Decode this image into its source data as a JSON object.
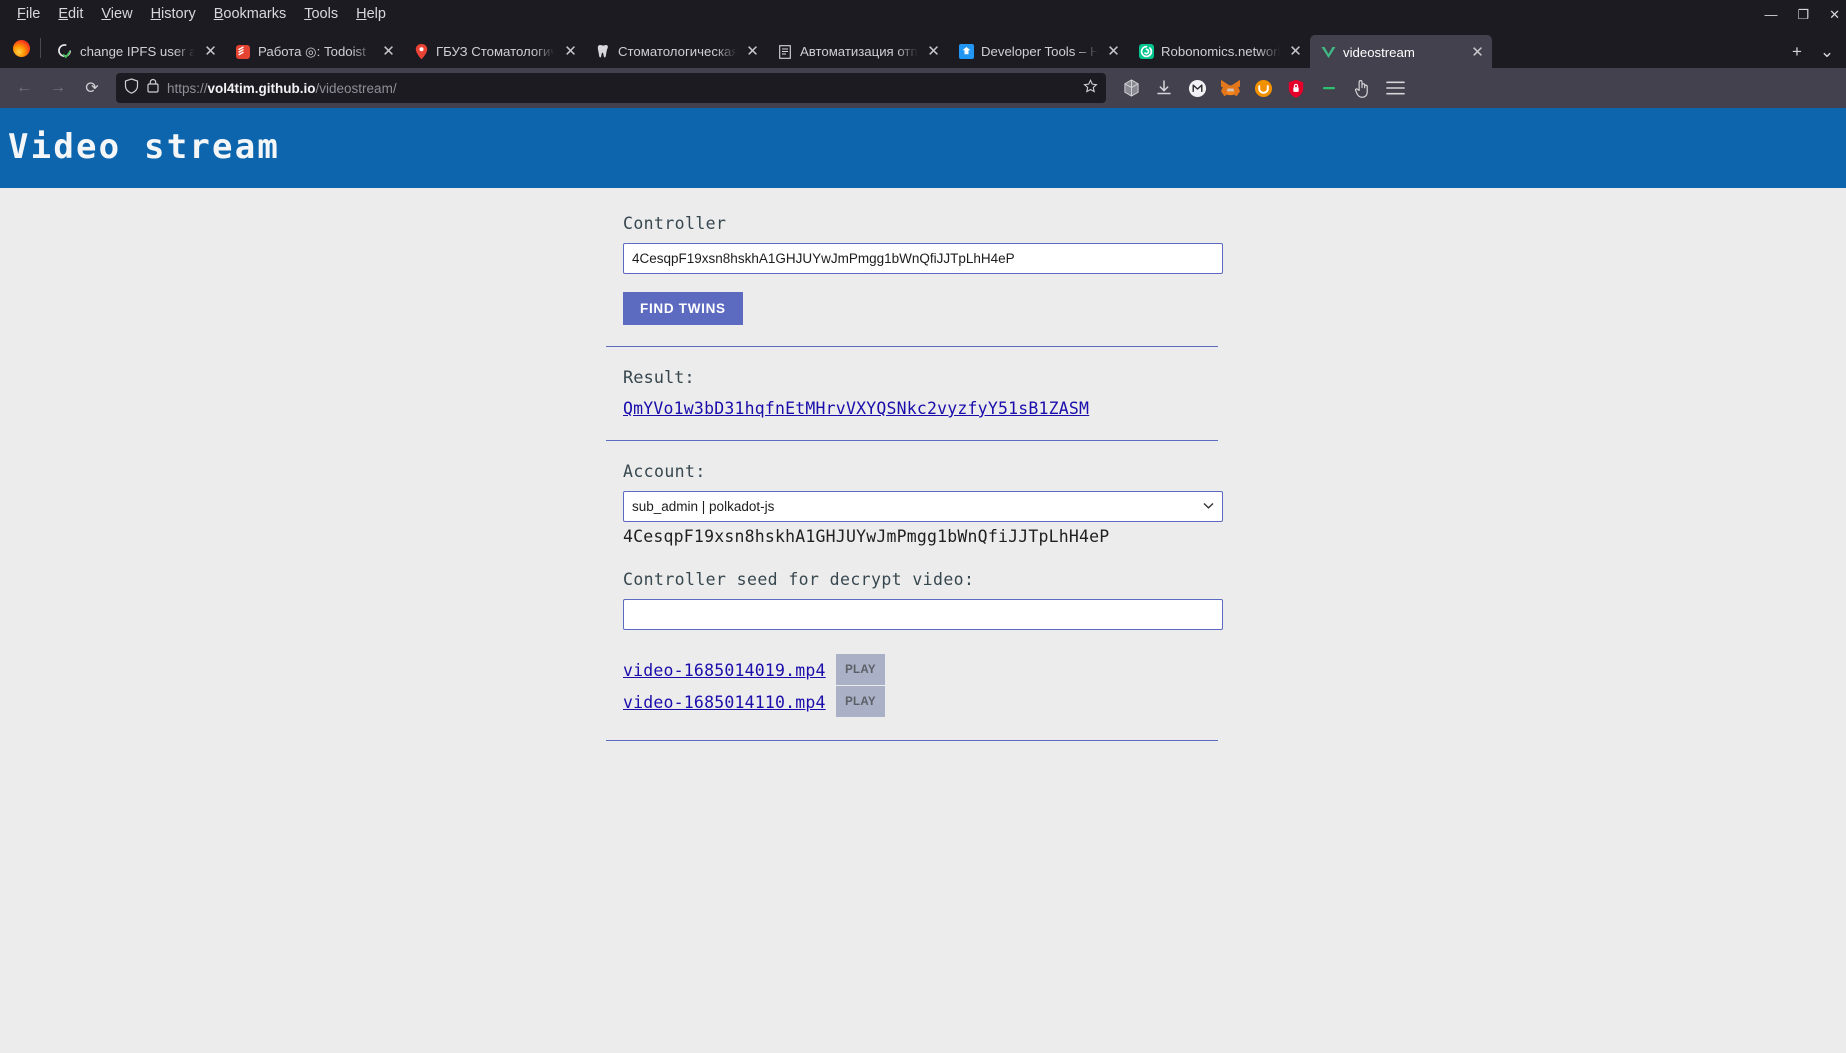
{
  "window": {
    "menu": [
      "File",
      "Edit",
      "View",
      "History",
      "Bookmarks",
      "Tools",
      "Help"
    ],
    "minimize": "—",
    "maximize": "❐",
    "close": "✕"
  },
  "tabs": [
    {
      "title": "change IPFS user and ad",
      "icon": "github-check-icon",
      "active": false
    },
    {
      "title": "Работа ◎: Todoist",
      "icon": "todoist-icon",
      "active": false
    },
    {
      "title": "ГБУЗ Стоматологическ",
      "icon": "map-pin-icon",
      "active": false
    },
    {
      "title": "Стоматологическая по",
      "icon": "tooth-icon",
      "active": false
    },
    {
      "title": "Автоматизация отправ",
      "icon": "document-icon",
      "active": false
    },
    {
      "title": "Developer Tools – Home",
      "icon": "developer-tools-icon",
      "active": false
    },
    {
      "title": "Robonomics.network | C",
      "icon": "robonomics-icon",
      "active": false
    },
    {
      "title": "videostream",
      "icon": "vue-icon",
      "active": true
    }
  ],
  "tab_controls": {
    "new_tab": "+",
    "tab_list": "⌄",
    "close": "✕"
  },
  "navigation": {
    "back": "←",
    "forward": "→",
    "reload": "⟳",
    "url_display": {
      "scheme": "https://",
      "host": "vol4tim.github.io",
      "path": "/videostream/"
    },
    "url_full": "https://vol4tim.github.io/videostream/",
    "shield_icon": "shield-icon",
    "lock_icon": "padlock-icon",
    "bookmark_icon": "star-outline-icon"
  },
  "toolbar_icons": [
    "cube-extension-icon",
    "downloads-icon",
    "metamask-m-icon",
    "metamask-fox-icon",
    "pocket-icon",
    "password-shield-icon",
    "green-dash-icon",
    "pointer-hand-icon",
    "app-menu-icon"
  ],
  "page": {
    "hero_title": "Video stream",
    "controller": {
      "label": "Controller",
      "value": "4CesqpF19xsn8hskhA1GHJUYwJmPmgg1bWnQfiJJTpLhH4eP",
      "placeholder": ""
    },
    "find_twins_button": "FIND TWINS",
    "result": {
      "label": "Result:",
      "hash": "QmYVo1w3bD31hqfnEtMHrvVXYQSNkc2vyzfyY51sB1ZASM"
    },
    "account": {
      "label": "Account:",
      "selected": "sub_admin | polkadot-js",
      "options": [
        "sub_admin | polkadot-js"
      ],
      "address": "4CesqpF19xsn8hskhA1GHJUYwJmPmgg1bWnQfiJJTpLhH4eP",
      "chevron": "▼"
    },
    "seed": {
      "label": "Controller seed for decrypt video:",
      "value": "",
      "placeholder": ""
    },
    "videos": [
      {
        "name": "video-1685014019.mp4",
        "play_label": "PLAY"
      },
      {
        "name": "video-1685014110.mp4",
        "play_label": "PLAY"
      }
    ]
  },
  "colors": {
    "hero_blue": "#0d65ad",
    "accent_indigo": "#5c6bc0",
    "link_blue": "#1a0dab",
    "page_bg": "#ececec",
    "play_button": "#aab0c6"
  }
}
